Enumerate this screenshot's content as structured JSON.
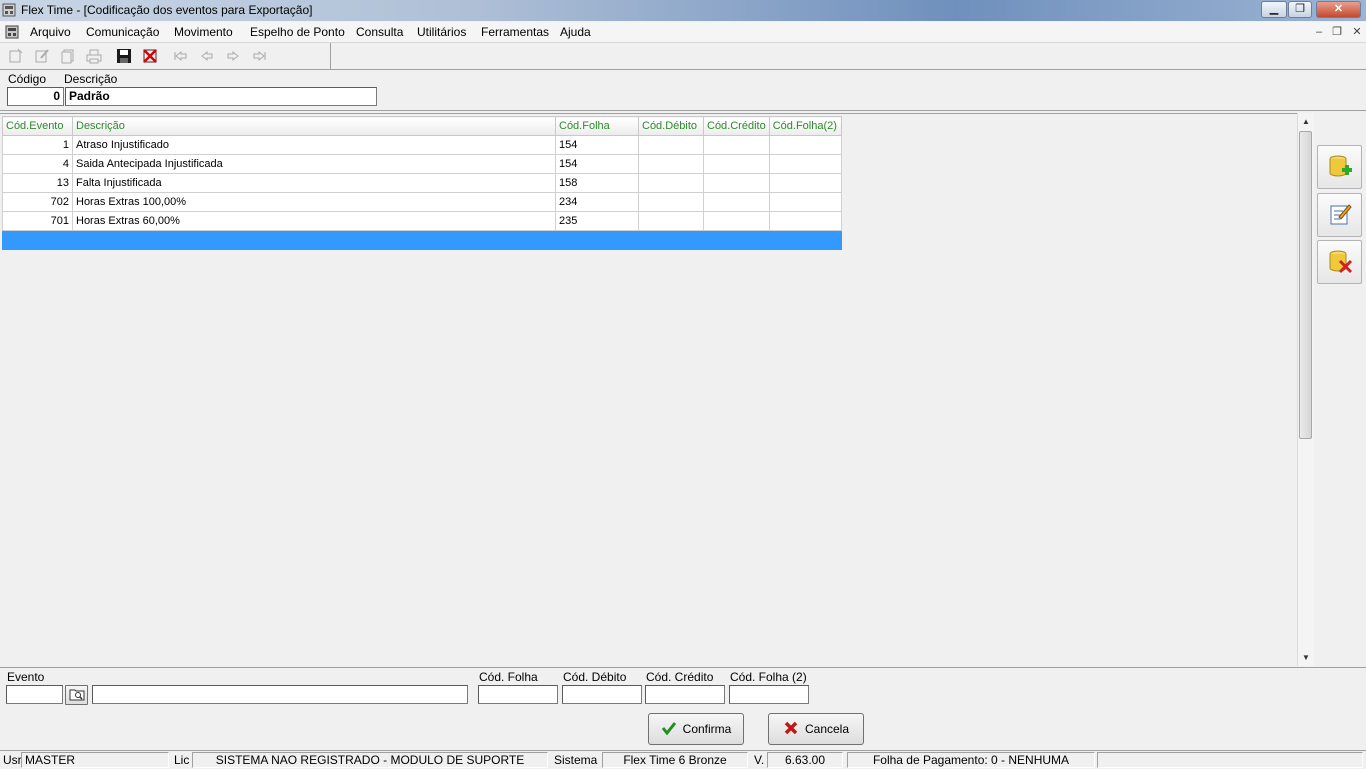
{
  "window": {
    "title": "Flex Time - [Codificação dos eventos para Exportação]",
    "caption_minimize": "▁",
    "caption_maximize": "❐",
    "caption_close": "✕"
  },
  "menu": {
    "items": [
      "Arquivo",
      "Comunicação",
      "Movimento",
      "Espelho de Ponto",
      "Consulta",
      "Utilitários",
      "Ferramentas",
      "Ajuda"
    ],
    "mdi_minimize": "–",
    "mdi_restore": "❐",
    "mdi_close": "✕"
  },
  "header": {
    "codigo_label": "Código",
    "descricao_label": "Descrição",
    "codigo_value": "0",
    "descricao_value": "Padrão"
  },
  "grid": {
    "columns": [
      "Cód.Evento",
      "Descrição",
      "Cód.Folha",
      "Cód.Débito",
      "Cód.Crédito",
      "Cód.Folha(2)"
    ],
    "rows": [
      [
        "1",
        "Atraso Injustificado",
        "154",
        "",
        "",
        ""
      ],
      [
        "4",
        "Saida Antecipada Injustificada",
        "154",
        "",
        "",
        ""
      ],
      [
        "13",
        "Falta Injustificada",
        "158",
        "",
        "",
        ""
      ],
      [
        "702",
        "Horas Extras 100,00%",
        "234",
        "",
        "",
        ""
      ],
      [
        "701",
        "Horas Extras 60,00%",
        "235",
        "",
        "",
        ""
      ],
      [
        "",
        "",
        "",
        "",
        "",
        ""
      ]
    ],
    "selected_row": 5
  },
  "editor": {
    "evento_label": "Evento",
    "cod_folha_label": "Cód. Folha",
    "cod_debito_label": "Cód. Débito",
    "cod_credito_label": "Cód. Crédito",
    "cod_folha2_label": "Cód. Folha (2)",
    "confirma_label": "Confirma",
    "cancela_label": "Cancela"
  },
  "statusbar": {
    "usr_label": "Usr",
    "usr_value": "MASTER",
    "lic_label": "Lic",
    "lic_value": "SISTEMA NAO REGISTRADO - MODULO DE SUPORTE",
    "sistema_label": "Sistema",
    "sistema_value": "Flex Time 6 Bronze",
    "version_label": "V.",
    "version_value": "6.63.00",
    "folha_value": "Folha de Pagamento: 0 - NENHUMA"
  },
  "colors": {
    "header_text": "#2e8b2e",
    "selection": "#3399ff"
  },
  "icons": {
    "toolbar": [
      "new-record-icon",
      "edit-record-icon",
      "copy-record-icon",
      "print-icon",
      "save-icon",
      "delete-icon",
      "first-icon",
      "previous-icon",
      "next-icon",
      "last-icon"
    ],
    "side": [
      "add-database-icon",
      "edit-document-icon",
      "delete-database-icon"
    ]
  }
}
